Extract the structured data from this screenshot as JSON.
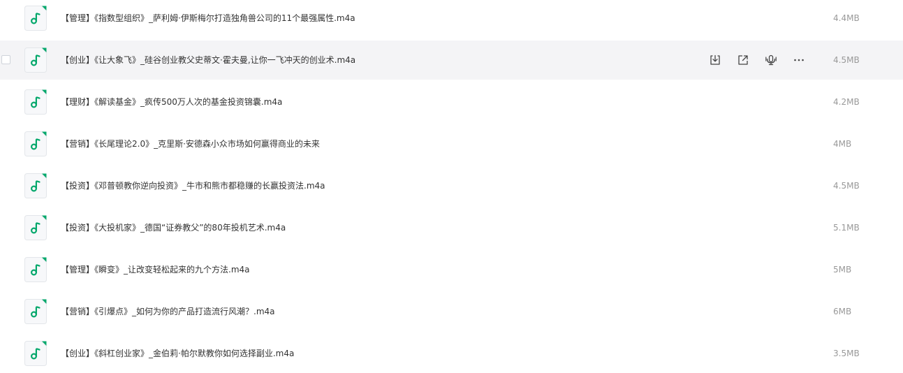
{
  "files": [
    {
      "name": "【管理】《指数型组织》_萨利姆·伊斯梅尔打造独角兽公司的11个最强属性.m4a",
      "size": "4.4MB"
    },
    {
      "name": "【创业】《让大象飞》_硅谷创业教父史蒂文·霍夫曼,让你一飞冲天的创业术.m4a",
      "size": "4.5MB"
    },
    {
      "name": "【理财】《解读基金》_疯传500万人次的基金投资锦囊.m4a",
      "size": "4.2MB"
    },
    {
      "name": "【营销】《长尾理论2.0》_克里斯·安德森小众市场如何赢得商业的未来",
      "size": "4MB"
    },
    {
      "name": "【投资】《邓普顿教你逆向投资》_牛市和熊市都稳赚的长赢投资法.m4a",
      "size": "4.5MB"
    },
    {
      "name": "【投资】《大投机家》_德国“证券教父”的80年投机艺术.m4a",
      "size": "5.1MB"
    },
    {
      "name": "【管理】《瞬变》_让改变轻松起来的九个方法.m4a",
      "size": "5MB"
    },
    {
      "name": "【营销】《引爆点》_如何为你的产品打造流行风潮？.m4a",
      "size": "6MB"
    },
    {
      "name": "【创业】《斜杠创业家》_金伯莉·帕尔默教你如何选择副业.m4a",
      "size": "3.5MB"
    }
  ],
  "hovered_row": 1,
  "row_actions": [
    "download-icon",
    "share-icon",
    "audio-transcribe-icon",
    "more-icon"
  ],
  "colors": {
    "icon_green": "#06a86c",
    "hover_bg": "#f4f4f6",
    "name_text": "#333333",
    "size_text": "#999999"
  }
}
